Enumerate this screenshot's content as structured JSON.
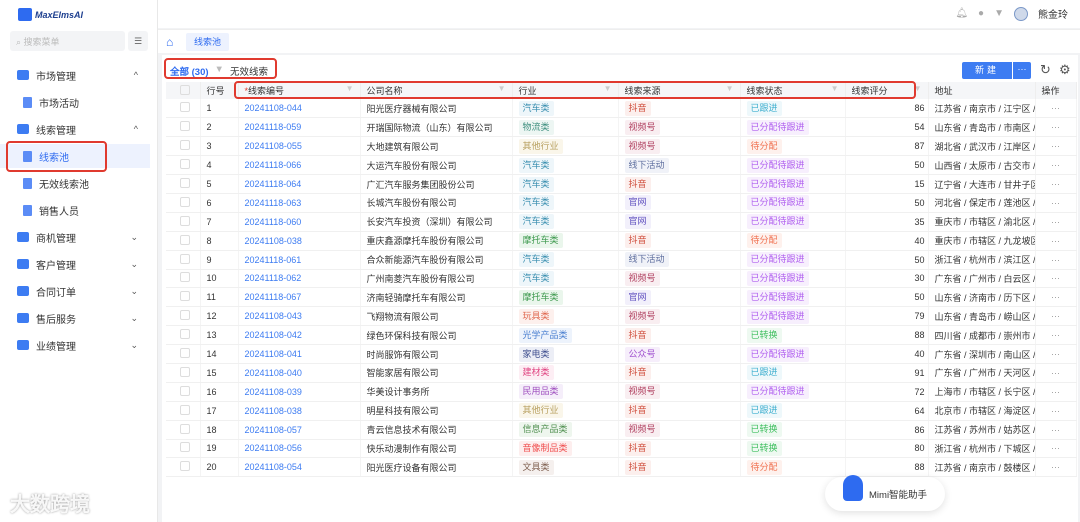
{
  "app": {
    "logo": "MaxElmsAI",
    "user": "熊金玲"
  },
  "sidebar": {
    "search_placeholder": "搜索菜单",
    "items": [
      {
        "label": "市场管理",
        "level": 1,
        "chev": "^"
      },
      {
        "label": "市场活动",
        "level": 2
      },
      {
        "label": "线索管理",
        "level": 1,
        "chev": "^"
      },
      {
        "label": "线索池",
        "level": 2,
        "active": true
      },
      {
        "label": "无效线索池",
        "level": 2
      },
      {
        "label": "销售人员",
        "level": 2
      },
      {
        "label": "商机管理",
        "level": 1,
        "chev": "⌄"
      },
      {
        "label": "客户管理",
        "level": 1,
        "chev": "⌄"
      },
      {
        "label": "合同订单",
        "level": 1,
        "chev": "⌄"
      },
      {
        "label": "售后服务",
        "level": 1,
        "chev": "⌄"
      },
      {
        "label": "业绩管理",
        "level": 1,
        "chev": "⌄"
      }
    ]
  },
  "tabs": {
    "current": "线索池"
  },
  "filter": {
    "all": "全部 (30)",
    "invalid": "无效线索"
  },
  "toolbar": {
    "new": "新建",
    "more": "···"
  },
  "table": {
    "headers": {
      "row": "行号",
      "id": "线索编号",
      "company": "公司名称",
      "industry": "行业",
      "source": "线索来源",
      "status": "线索状态",
      "score": "线索评分",
      "address": "地址",
      "ops": "操作"
    },
    "rows": [
      [
        "1",
        "20241108-044",
        "阳光医疗器械有限公司",
        "汽车类",
        "抖音",
        "已跟进",
        "86",
        "江苏省 / 南京市 / 江宁区 / ..."
      ],
      [
        "2",
        "20241118-059",
        "开瑞国际物流（山东）有限公司",
        "物流类",
        "视频号",
        "已分配待跟进",
        "54",
        "山东省 / 青岛市 / 市南区 / ..."
      ],
      [
        "3",
        "20241108-055",
        "大地建筑有限公司",
        "其他行业",
        "视频号",
        "待分配",
        "87",
        "湖北省 / 武汉市 / 江岸区 / ..."
      ],
      [
        "4",
        "20241118-066",
        "大运汽车股份有限公司",
        "汽车类",
        "线下活动",
        "已分配待跟进",
        "50",
        "山西省 / 太原市 / 古交市 / ..."
      ],
      [
        "5",
        "20241118-064",
        "广汇汽车服务集团股份公司",
        "汽车类",
        "抖音",
        "已分配待跟进",
        "15",
        "辽宁省 / 大连市 / 甘井子区"
      ],
      [
        "6",
        "20241118-063",
        "长城汽车股份有限公司",
        "汽车类",
        "官网",
        "已分配待跟进",
        "50",
        "河北省 / 保定市 / 莲池区 / ..."
      ],
      [
        "7",
        "20241118-060",
        "长安汽车投资（深圳）有限公司",
        "汽车类",
        "官网",
        "已分配待跟进",
        "35",
        "重庆市 / 市辖区 / 渝北区 / ..."
      ],
      [
        "8",
        "20241108-038",
        "重庆鑫源摩托车股份有限公司",
        "摩托车类",
        "抖音",
        "待分配",
        "40",
        "重庆市 / 市辖区 / 九龙坡区"
      ],
      [
        "9",
        "20241118-061",
        "合众新能源汽车股份有限公司",
        "汽车类",
        "线下活动",
        "已分配待跟进",
        "50",
        "浙江省 / 杭州市 / 滨江区 / ..."
      ],
      [
        "10",
        "20241118-062",
        "广州南菱汽车股份有限公司",
        "汽车类",
        "视频号",
        "已分配待跟进",
        "30",
        "广东省 / 广州市 / 白云区 / ..."
      ],
      [
        "11",
        "20241118-067",
        "济南轻骑摩托车有限公司",
        "摩托车类",
        "官网",
        "已分配待跟进",
        "50",
        "山东省 / 济南市 / 历下区 / ..."
      ],
      [
        "12",
        "20241108-043",
        "飞翔物流有限公司",
        "玩具类",
        "视频号",
        "已分配待跟进",
        "79",
        "山东省 / 青岛市 / 崂山区 / ..."
      ],
      [
        "13",
        "20241108-042",
        "绿色环保科技有限公司",
        "光学产品类",
        "抖音",
        "已转换",
        "88",
        "四川省 / 成都市 / 崇州市 / ..."
      ],
      [
        "14",
        "20241108-041",
        "时尚服饰有限公司",
        "家电类",
        "公众号",
        "已分配待跟进",
        "40",
        "广东省 / 深圳市 / 南山区 / ..."
      ],
      [
        "15",
        "20241108-040",
        "智能家居有限公司",
        "建材类",
        "抖音",
        "已跟进",
        "91",
        "广东省 / 广州市 / 天河区 / ..."
      ],
      [
        "16",
        "20241108-039",
        "华美设计事务所",
        "民用品类",
        "视频号",
        "已分配待跟进",
        "72",
        "上海市 / 市辖区 / 长宁区 / ..."
      ],
      [
        "17",
        "20241108-038",
        "明星科技有限公司",
        "其他行业",
        "抖音",
        "已跟进",
        "64",
        "北京市 / 市辖区 / 海淀区 / ..."
      ],
      [
        "18",
        "20241108-057",
        "青云信息技术有限公司",
        "信息产品类",
        "视频号",
        "已转换",
        "86",
        "江苏省 / 苏州市 / 姑苏区 / ..."
      ],
      [
        "19",
        "20241108-056",
        "快乐动漫制作有限公司",
        "音像制品类",
        "抖音",
        "已转换",
        "80",
        "浙江省 / 杭州市 / 下城区 / ..."
      ],
      [
        "20",
        "20241108-054",
        "阳光医疗设备有限公司",
        "文具类",
        "抖音",
        "待分配",
        "88",
        "江苏省 / 南京市 / 鼓楼区 / ..."
      ]
    ],
    "ops_label": "···"
  },
  "tag_colors": {
    "汽车类": [
      "#3a8fb0",
      "#eef6fa"
    ],
    "物流类": [
      "#3f8f7f",
      "#edf6f3"
    ],
    "其他行业": [
      "#b8a060",
      "#faf6ea"
    ],
    "摩托车类": [
      "#3f9a4f",
      "#eaf6ec"
    ],
    "玩具类": [
      "#e0684f",
      "#fdf0ed"
    ],
    "光学产品类": [
      "#4a7fd0",
      "#edf3fc"
    ],
    "家电类": [
      "#3f4f8f",
      "#eceef6"
    ],
    "建材类": [
      "#e0407f",
      "#fdeef4"
    ],
    "民用品类": [
      "#9f4fbf",
      "#f5eefa"
    ],
    "信息产品类": [
      "#4f8f4f",
      "#eef6ee"
    ],
    "音像制品类": [
      "#f05050",
      "#fdeeee"
    ],
    "文具类": [
      "#7f6050",
      "#f5f0ee"
    ],
    "抖音": [
      "#d0503f",
      "#fcefed"
    ],
    "视频号": [
      "#b03f5f",
      "#f9eef1"
    ],
    "线下活动": [
      "#5f6f9f",
      "#f0f2f8"
    ],
    "官网": [
      "#5f4fbf",
      "#f2f0fb"
    ],
    "公众号": [
      "#9f4fcf",
      "#f6eefb"
    ],
    "已跟进": [
      "#3fafcf",
      "#eef8fb"
    ],
    "已分配待跟进": [
      "#b05fef",
      "#f7effd"
    ],
    "待分配": [
      "#f0704f",
      "#fef1ed"
    ],
    "已转换": [
      "#3fbf5f",
      "#eef9f1"
    ]
  },
  "assistant": {
    "label": "Mimi智能助手"
  },
  "watermark": "大数跨境"
}
